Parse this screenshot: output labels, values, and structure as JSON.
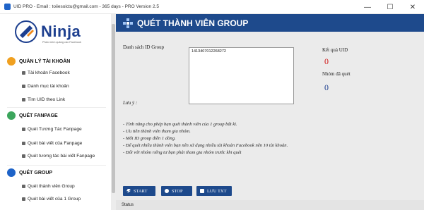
{
  "window": {
    "title": "UID PRO - Email : toiiesoictu@gmail.com - 365 days - PRO Version 2.5",
    "minimize": "—",
    "maximize": "☐",
    "close": "✕"
  },
  "logo": {
    "text": "Ninja",
    "tagline": "Phần mềm quảng cáo Facebook"
  },
  "sidebar": {
    "sections": [
      {
        "title": "QUẢN LÝ TÀI KHOẢN",
        "icon": "user-icon",
        "color": "#f0a020",
        "items": [
          "Tài khoản Facebook",
          "Danh mục tài khoản",
          "Tìm UID theo Link"
        ]
      },
      {
        "title": "QUÉT FANPAGE",
        "icon": "leaf-icon",
        "color": "#3ba55c",
        "items": [
          "Quét Tương Tác Fanpage",
          "Quét bài viết của Fanpage",
          "Quét tương tác bài viết Fanpage"
        ]
      },
      {
        "title": "QUÉT GROUP",
        "icon": "dots-icon",
        "color": "#1e63c8",
        "items": [
          "Quét thành viên Group",
          "Quét bài viết của 1 Group"
        ]
      }
    ]
  },
  "main": {
    "header_title": "QUÉT THÀNH VIÊN GROUP",
    "id_list_label": "Danh sách ID Group",
    "id_list_value": "1413407012268272",
    "result_label": "Kết quả UID",
    "result_value": "0",
    "groups_label": "Nhóm đã quét",
    "groups_value": "0",
    "note_label": "Lưu ý :",
    "notes": [
      "- Tính năng cho phép bạn quét thành viên của 1 group bất kì.",
      "- Ưu tiên thành viên tham gia nhóm.",
      "- Mỗi ID group điền 1 dòng.",
      "- Để quét nhiều thành viên bạn nên sử dụng nhiều tài khoản Facebook nên 10 tài khoản.",
      "- Đối với nhóm riêng tư bạn phải tham gia nhóm trước khi quét"
    ],
    "buttons": {
      "start": "START",
      "stop": "STOP",
      "save": "LƯU TXT"
    },
    "status": "Status"
  },
  "colors": {
    "header_bg": "#1e4a8c",
    "result_color": "#d01818",
    "groups_color": "#1e3f8f"
  }
}
